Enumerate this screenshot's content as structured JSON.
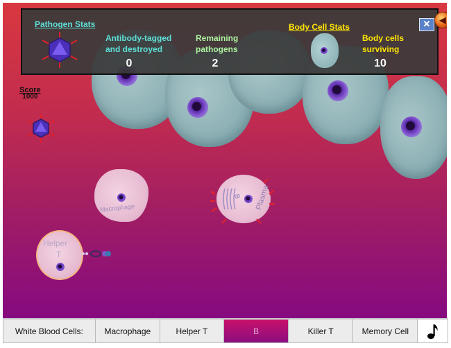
{
  "pathogen_stats": {
    "title": "Pathogen Stats",
    "tagged_label_line1": "Antibody-tagged",
    "tagged_label_line2": "and destroyed",
    "tagged_value": "0",
    "remaining_label_line1": "Remaining",
    "remaining_label_line2": "pathogens",
    "remaining_value": "2"
  },
  "body_cell_stats": {
    "title": "Body Cell Stats",
    "surviving_label_line1": "Body cells",
    "surviving_label_line2": "surviving",
    "surviving_value": "10"
  },
  "score": {
    "label": "Score",
    "value": "1000"
  },
  "cells": {
    "macrophage_label": "Macrophage",
    "helper_label_line1": "Helper",
    "helper_label_line2": "T",
    "plasma_label": "Plasma",
    "plasma_b_label": "B"
  },
  "taskbar": {
    "white_blood_cells": "White Blood Cells:",
    "macrophage": "Macrophage",
    "helper_t": "Helper T",
    "b": "B",
    "killer_t": "Killer T",
    "memory_cell": "Memory Cell"
  },
  "icons": {
    "close": "close-x-icon",
    "back": "back-arrow-icon",
    "music": "music-note-icon",
    "pathogen": "virus-icon"
  },
  "colors": {
    "pathogen_stats_title": "#5ee0d8",
    "pathogen_stats_labels": "#5ee0d8",
    "remaining_labels": "#aef2a0",
    "body_cell_title": "#ffe600",
    "body_cell_labels": "#ffe600",
    "background_top": "#d8383f",
    "background_bottom": "#860a80"
  }
}
